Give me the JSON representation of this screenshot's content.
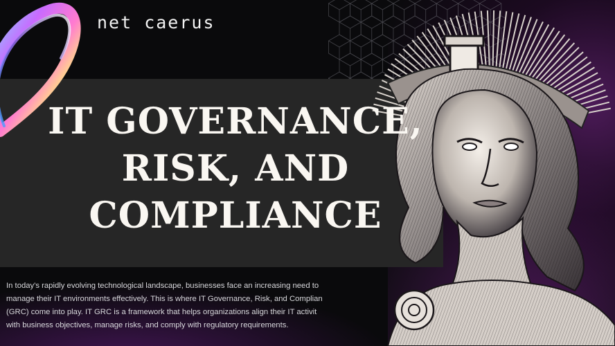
{
  "brand": "net caerus",
  "title_lines": [
    "IT GOVERNANCE,",
    "RISK, AND",
    "COMPLIANCE"
  ],
  "body_lines": [
    "In today's rapidly evolving technological landscape, businesses face an increasing need to",
    "manage their IT environments effectively. This is where IT Governance, Risk, and Complian",
    "(GRC) come into play. IT GRC is a framework that helps organizations align their IT activit",
    "with business objectives, manage risks, and comply with regulatory requirements."
  ],
  "colors": {
    "background": "#0a0a0c",
    "band": "#262626",
    "accent": "#7a2a8e",
    "text": "#faf7f2"
  },
  "icons": [
    "holographic-ring",
    "hexagon-grid",
    "goddess-statue-illustration"
  ]
}
